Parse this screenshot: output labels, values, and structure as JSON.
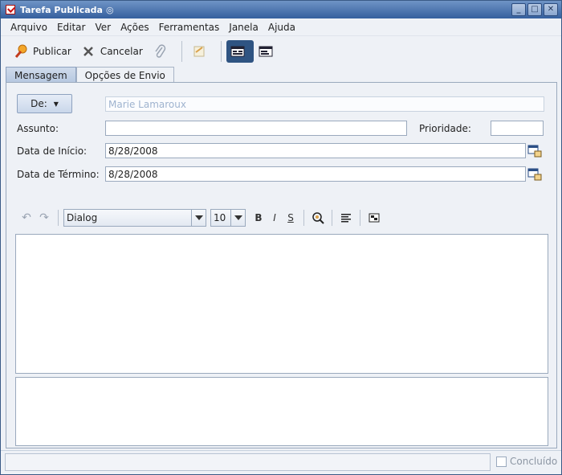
{
  "window": {
    "title": "Tarefa Publicada",
    "controls": [
      "_",
      "□",
      "✕"
    ]
  },
  "menubar": {
    "items": [
      "Arquivo",
      "Editar",
      "Ver",
      "Ações",
      "Ferramentas",
      "Janela",
      "Ajuda"
    ]
  },
  "toolbar": {
    "publish_label": "Publicar",
    "cancel_label": "Cancelar"
  },
  "tabs": [
    "Mensagem",
    "Opções de Envio"
  ],
  "form": {
    "from_button": "De:",
    "from_value": "Marie Lamaroux",
    "subject_label": "Assunto:",
    "subject_value": "",
    "priority_label": "Prioridade:",
    "priority_value": "",
    "start_label": "Data de Início:",
    "start_value": "8/28/2008",
    "end_label": "Data de Término:",
    "end_value": "8/28/2008"
  },
  "editor": {
    "font": "Dialog",
    "size": "10",
    "bold": "B",
    "italic": "I",
    "strike": "S"
  },
  "status": {
    "done_label": "Concluído"
  }
}
